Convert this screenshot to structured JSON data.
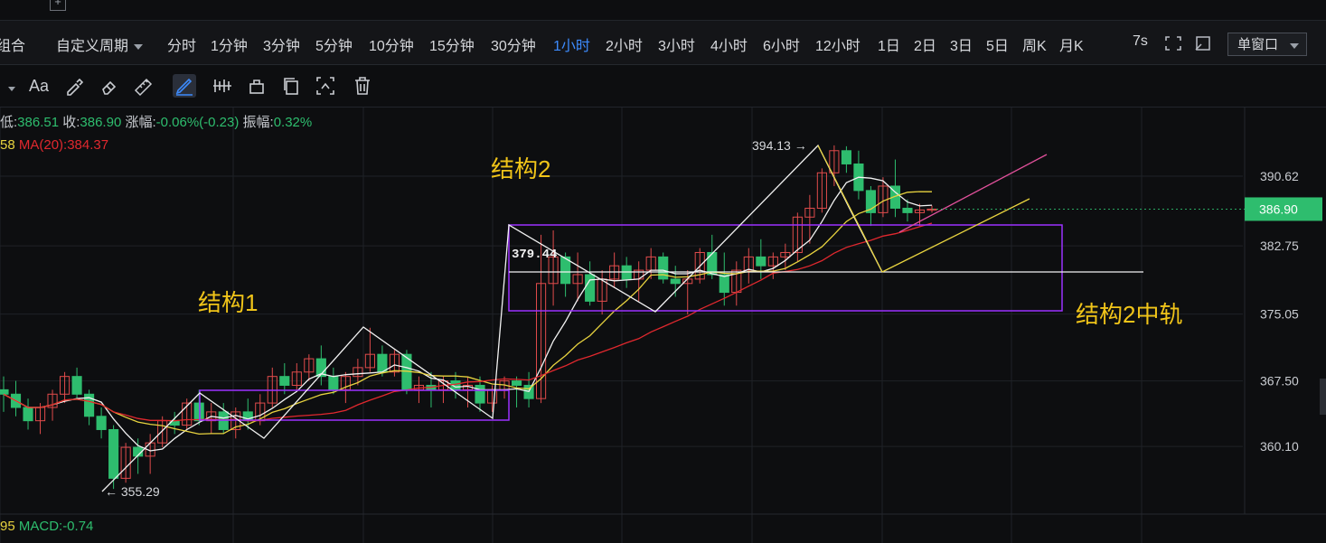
{
  "top_tab": {
    "icon": "add-tab-icon"
  },
  "period_bar": {
    "left_label": "组合",
    "custom_label": "自定义周期",
    "periods": [
      "分时",
      "1分钟",
      "3分钟",
      "5分钟",
      "10分钟",
      "15分钟",
      "30分钟",
      "1小时",
      "2小时",
      "3小时",
      "4小时",
      "6小时",
      "12小时",
      "1日",
      "2日",
      "3日",
      "5日",
      "周K",
      "月K"
    ],
    "active_period": "1小时",
    "refresh_label": "7s",
    "window_select": "单窗口"
  },
  "toolbar": {
    "text_tool_label": "Aa",
    "icons": [
      "dropdown-caret-icon",
      "text-tool-icon",
      "brush-icon",
      "eraser-icon",
      "ruler-icon",
      "pen-tool-icon",
      "bar-pattern-icon",
      "lock-icon",
      "copy-icon",
      "screenshot-icon",
      "trash-icon"
    ]
  },
  "info": {
    "low_label": "低:",
    "low_value": "386.51",
    "close_label": "收:",
    "close_value": "386.90",
    "change_label": "涨幅:",
    "change_value": "-0.06%(-0.23)",
    "amp_label": "振幅:",
    "amp_value": "0.32%"
  },
  "ma": {
    "prefix": "58",
    "ma20_label": "MA(20):384.37"
  },
  "macd": {
    "prefix": "95",
    "label": "MACD:-0.74"
  },
  "colors": {
    "up": "#e04b4b",
    "down": "#2ebd6e",
    "ma_white": "#f2f2f2",
    "ma_yellow": "#e8d33f",
    "ma_red": "#e0282e",
    "box": "#9b30ff",
    "annotation": "#f0c419",
    "active": "#3d8bfd"
  },
  "chart_data": {
    "type": "candlestick",
    "y_ticks": [
      390.62,
      382.75,
      375.05,
      367.5,
      360.1
    ],
    "current_price": "386.90",
    "annotations": {
      "high": "394.13",
      "low": "355.29",
      "mid": "379.44",
      "structure1": "结构1",
      "structure2": "结构2",
      "structure2_mid": "结构2中轨"
    },
    "candles": [
      [
        366.5,
        368.0,
        364.0,
        366.0
      ],
      [
        366.0,
        367.5,
        363.5,
        364.5
      ],
      [
        364.5,
        365.5,
        362.0,
        363.0
      ],
      [
        363.0,
        365.0,
        361.5,
        364.5
      ],
      [
        364.5,
        366.5,
        363.0,
        366.0
      ],
      [
        366.0,
        368.5,
        365.0,
        368.0
      ],
      [
        368.0,
        369.0,
        365.5,
        366.0
      ],
      [
        366.0,
        366.5,
        362.5,
        363.5
      ],
      [
        363.5,
        364.5,
        361.0,
        362.0
      ],
      [
        362.0,
        362.5,
        355.3,
        356.5
      ],
      [
        356.5,
        360.5,
        356.0,
        360.0
      ],
      [
        360.0,
        361.0,
        357.0,
        359.0
      ],
      [
        359.0,
        361.5,
        357.0,
        360.5
      ],
      [
        360.5,
        363.5,
        360.0,
        363.0
      ],
      [
        363.0,
        364.0,
        361.5,
        362.5
      ],
      [
        362.5,
        365.5,
        362.0,
        365.0
      ],
      [
        365.0,
        366.5,
        362.5,
        363.0
      ],
      [
        363.0,
        365.0,
        361.5,
        364.0
      ],
      [
        364.0,
        365.0,
        361.5,
        362.0
      ],
      [
        362.0,
        364.5,
        361.0,
        364.0
      ],
      [
        364.0,
        365.5,
        362.0,
        363.0
      ],
      [
        363.0,
        366.0,
        362.5,
        365.0
      ],
      [
        365.0,
        369.0,
        364.5,
        368.0
      ],
      [
        368.0,
        369.5,
        366.0,
        367.0
      ],
      [
        367.0,
        369.5,
        366.5,
        368.5
      ],
      [
        368.5,
        370.5,
        367.5,
        370.0
      ],
      [
        370.0,
        371.5,
        367.0,
        368.0
      ],
      [
        368.0,
        369.0,
        366.0,
        366.5
      ],
      [
        366.5,
        368.5,
        365.0,
        368.0
      ],
      [
        368.0,
        370.0,
        367.0,
        369.0
      ],
      [
        369.0,
        373.5,
        368.5,
        370.5
      ],
      [
        370.5,
        371.5,
        368.0,
        368.5
      ],
      [
        368.5,
        371.0,
        368.0,
        370.5
      ],
      [
        370.5,
        371.0,
        366.0,
        366.5
      ],
      [
        366.5,
        368.0,
        365.0,
        367.0
      ],
      [
        367.0,
        368.5,
        364.5,
        366.5
      ],
      [
        366.5,
        368.0,
        365.0,
        367.5
      ],
      [
        367.5,
        368.5,
        365.5,
        366.5
      ],
      [
        366.5,
        368.0,
        364.5,
        367.0
      ],
      [
        367.0,
        368.0,
        364.0,
        365.0
      ],
      [
        365.0,
        367.0,
        364.0,
        366.5
      ],
      [
        366.5,
        368.0,
        365.5,
        367.5
      ],
      [
        367.5,
        368.0,
        364.5,
        367.0
      ],
      [
        367.0,
        368.5,
        364.5,
        365.5
      ],
      [
        365.5,
        384.0,
        365.0,
        378.5
      ],
      [
        378.5,
        384.5,
        376.0,
        381.5
      ],
      [
        381.5,
        382.0,
        377.0,
        378.5
      ],
      [
        378.5,
        382.0,
        376.5,
        379.5
      ],
      [
        379.5,
        381.0,
        376.0,
        376.5
      ],
      [
        376.5,
        380.0,
        375.0,
        379.0
      ],
      [
        379.0,
        382.0,
        378.0,
        380.5
      ],
      [
        380.5,
        381.5,
        378.0,
        379.0
      ],
      [
        379.0,
        381.0,
        376.5,
        380.0
      ],
      [
        380.0,
        382.5,
        379.0,
        381.5
      ],
      [
        381.5,
        382.0,
        378.5,
        379.0
      ],
      [
        379.0,
        380.5,
        377.0,
        378.5
      ],
      [
        378.5,
        380.0,
        375.0,
        379.0
      ],
      [
        379.0,
        382.5,
        378.5,
        382.0
      ],
      [
        382.0,
        384.0,
        379.0,
        379.5
      ],
      [
        379.5,
        382.0,
        376.0,
        377.5
      ],
      [
        377.5,
        381.0,
        376.0,
        380.0
      ],
      [
        380.0,
        382.5,
        378.5,
        381.5
      ],
      [
        381.5,
        383.5,
        379.0,
        380.5
      ],
      [
        380.5,
        382.0,
        379.0,
        381.5
      ],
      [
        381.5,
        383.0,
        380.0,
        382.0
      ],
      [
        382.0,
        386.5,
        381.0,
        386.0
      ],
      [
        386.0,
        388.5,
        383.0,
        387.0
      ],
      [
        387.0,
        391.5,
        386.5,
        391.0
      ],
      [
        391.0,
        394.1,
        389.5,
        393.5
      ],
      [
        393.5,
        394.0,
        391.0,
        392.0
      ],
      [
        392.0,
        393.5,
        388.0,
        389.0
      ],
      [
        389.0,
        389.5,
        385.0,
        386.5
      ],
      [
        386.5,
        390.5,
        386.0,
        389.5
      ],
      [
        389.5,
        392.5,
        386.0,
        387.0
      ],
      [
        387.0,
        388.0,
        385.5,
        386.5
      ],
      [
        386.5,
        387.5,
        385.0,
        386.8
      ],
      [
        386.8,
        387.3,
        386.5,
        386.9
      ]
    ]
  }
}
